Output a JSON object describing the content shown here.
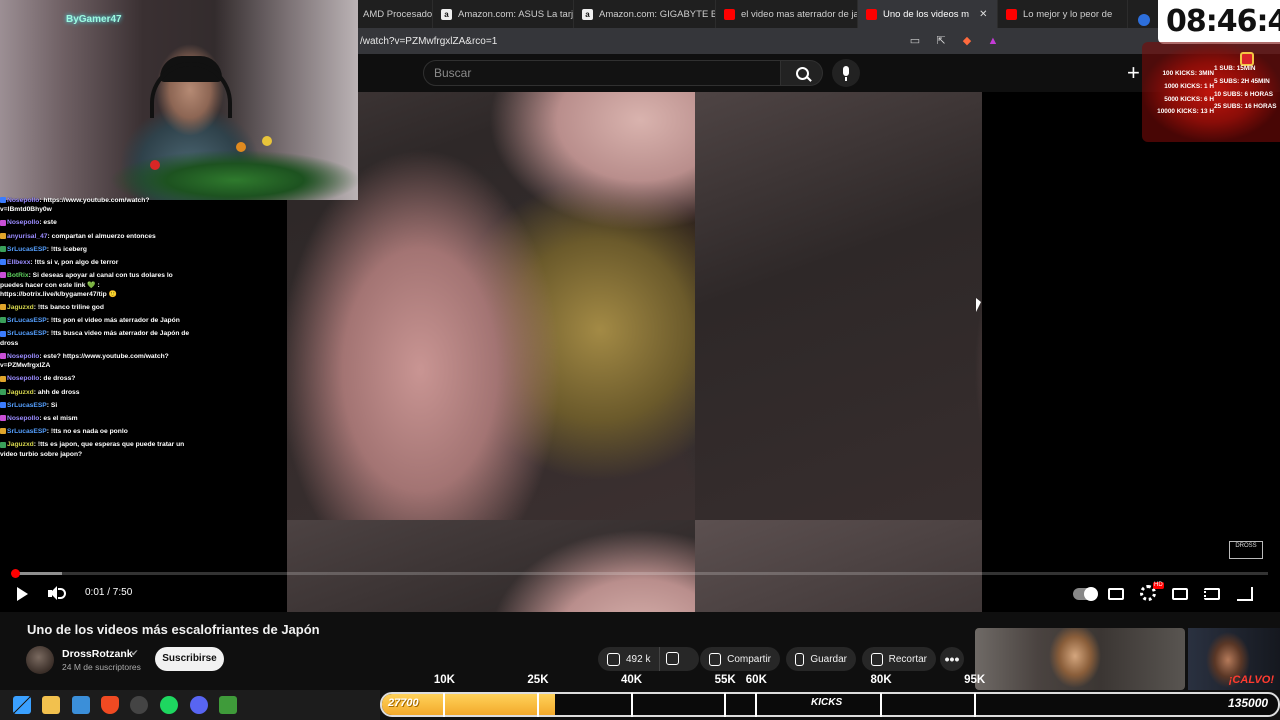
{
  "browser": {
    "tabs": [
      {
        "label": "AMD Procesado",
        "favicon": "amd",
        "active": false
      },
      {
        "label": "Amazon.com: ASUS La tarjeta",
        "favicon": "amazon",
        "active": false
      },
      {
        "label": "Amazon.com: GIGABYTE B650",
        "favicon": "amazon",
        "active": false
      },
      {
        "label": "el video mas aterrador de jap",
        "favicon": "youtube",
        "active": false
      },
      {
        "label": "Uno de los videos m",
        "favicon": "youtube",
        "active": true
      },
      {
        "label": "Lo mejor y lo peor de",
        "favicon": "youtube",
        "active": false
      }
    ],
    "url": "/watch?v=PZMwfrgxlZA&rco=1"
  },
  "youtube": {
    "search_placeholder": "Buscar",
    "create_label": "+",
    "video": {
      "elapsed": "0:01",
      "duration": "7:50",
      "time_display": "0:01 / 7:50",
      "progress_played": 0.002,
      "progress_loaded": 0.04,
      "watermark": "DROSS"
    },
    "title": "Uno de los videos más escalofriantes de Japón",
    "channel": {
      "name": "DrossRotzank",
      "verified_mark": "✔",
      "subscribers": "24 M de suscriptores",
      "subscribe_label": "Suscribirse"
    },
    "actions": {
      "likes": "492 k",
      "share": "Compartir",
      "save": "Guardar",
      "clip": "Recortar",
      "more": "•••"
    },
    "suggested": [
      {
        "thumb_label": ""
      },
      {
        "thumb_label": "¡CALVO!"
      }
    ]
  },
  "stream_overlay": {
    "brand": "ByGamer47",
    "clock": "08:46:47",
    "goals_kicks": [
      "100 KICKS: 3MIN",
      "1000 KICKS: 1 H",
      "5000 KICKS: 6 H",
      "10000 KICKS: 13 H"
    ],
    "goals_subs": [
      "1 SUB: 15MIN",
      "5 SUBS: 2H 45MIN",
      "10 SUBS: 6 HORAS",
      "25 SUBS: 16 HORAS"
    ],
    "kicks_bar": {
      "label": "KICKS",
      "current": "27700",
      "current_value": 27700,
      "goal": "135000",
      "goal_value": 135000,
      "milestones": [
        "10K",
        "25K",
        "40K",
        "55K",
        "60K",
        "80K",
        "95K"
      ],
      "milestone_values": [
        10000,
        25000,
        40000,
        55000,
        60000,
        80000,
        95000
      ]
    },
    "chat": [
      {
        "user": "Nosepollo",
        "color": "purple",
        "text": ": https://www.youtube.com/watch?v=lBmtd0Bhy0w"
      },
      {
        "user": "Nosepollo",
        "color": "purple",
        "text": ": este"
      },
      {
        "user": "anyurisal_47",
        "color": "purple",
        "text": ": compartan el almuerzo entonces"
      },
      {
        "user": "SrLucasESP",
        "color": "blue",
        "text": ": !tts iceberg"
      },
      {
        "user": "Ellbexx",
        "color": "purple",
        "text": ": !tts si v, pon algo de terror"
      },
      {
        "user": "BotRix",
        "color": "green",
        "text": ": Si deseas apoyar al canal con tus dolares lo puedes hacer con este link 💚 : https://botrix.live/k/bygamer47/tip 🙂"
      },
      {
        "user": "Jaguzxd",
        "color": "yellow",
        "text": ": !tts banco triline god"
      },
      {
        "user": "SrLucasESP",
        "color": "blue",
        "text": ": !tts pon el video más aterrador de Japón"
      },
      {
        "user": "SrLucasESP",
        "color": "blue",
        "text": ": !tts busca video más aterrador de Japón de dross"
      },
      {
        "user": "Nosepollo",
        "color": "purple",
        "text": ": este? https://www.youtube.com/watch?v=PZMwfrgxlZA"
      },
      {
        "user": "Nosepollo",
        "color": "purple",
        "text": ": de dross?"
      },
      {
        "user": "Jaguzxd",
        "color": "yellow",
        "text": ": ahh de dross"
      },
      {
        "user": "SrLucasESP",
        "color": "blue",
        "text": ": Si"
      },
      {
        "user": "Nosepollo",
        "color": "purple",
        "text": ": es el mism"
      },
      {
        "user": "SrLucasESP",
        "color": "blue",
        "text": ": !tts no es nada oe ponlo"
      },
      {
        "user": "Jaguzxd",
        "color": "yellow",
        "text": ": !tts es japon, que esperas que puede tratar un video turbio sobre japon?"
      }
    ]
  },
  "colors": {
    "youtube_red": "#ff0000",
    "kicks_fill": "#f3a92b",
    "goals_red": "#c0140c"
  }
}
